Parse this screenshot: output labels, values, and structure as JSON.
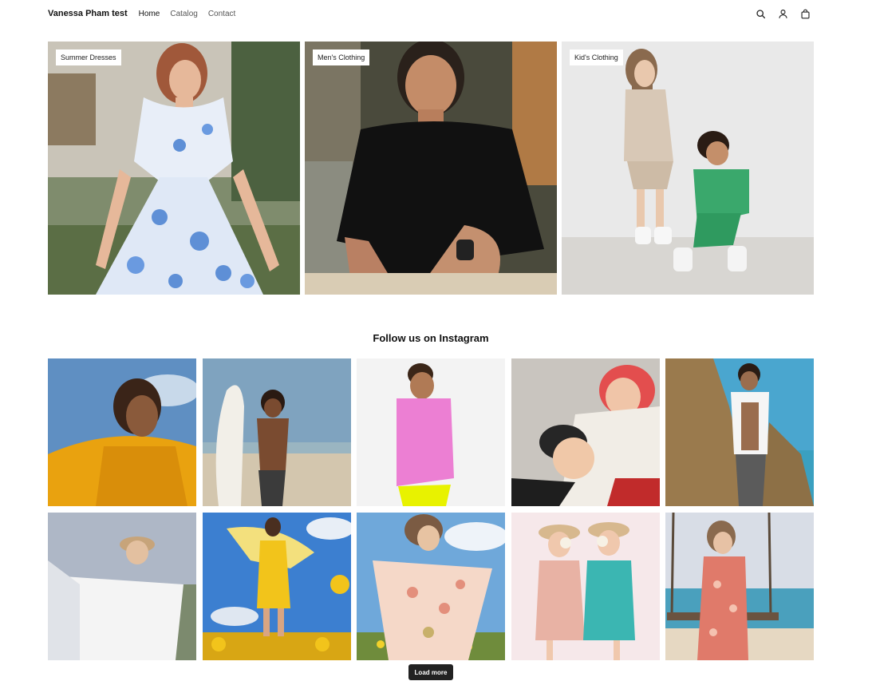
{
  "header": {
    "brand": "Vanessa Pham test",
    "nav": [
      {
        "label": "Home"
      },
      {
        "label": "Catalog"
      },
      {
        "label": "Contact"
      }
    ],
    "icons": [
      "search-icon",
      "account-icon",
      "cart-icon"
    ]
  },
  "collections": [
    {
      "label": "Summer Dresses"
    },
    {
      "label": "Men's Clothing"
    },
    {
      "label": "Kid's Clothing"
    }
  ],
  "instagram": {
    "title": "Follow us on Instagram",
    "load_more_label": "Load more"
  },
  "colors": {
    "accent_button": "#222222",
    "text": "#111111",
    "nav_text": "#555555"
  }
}
